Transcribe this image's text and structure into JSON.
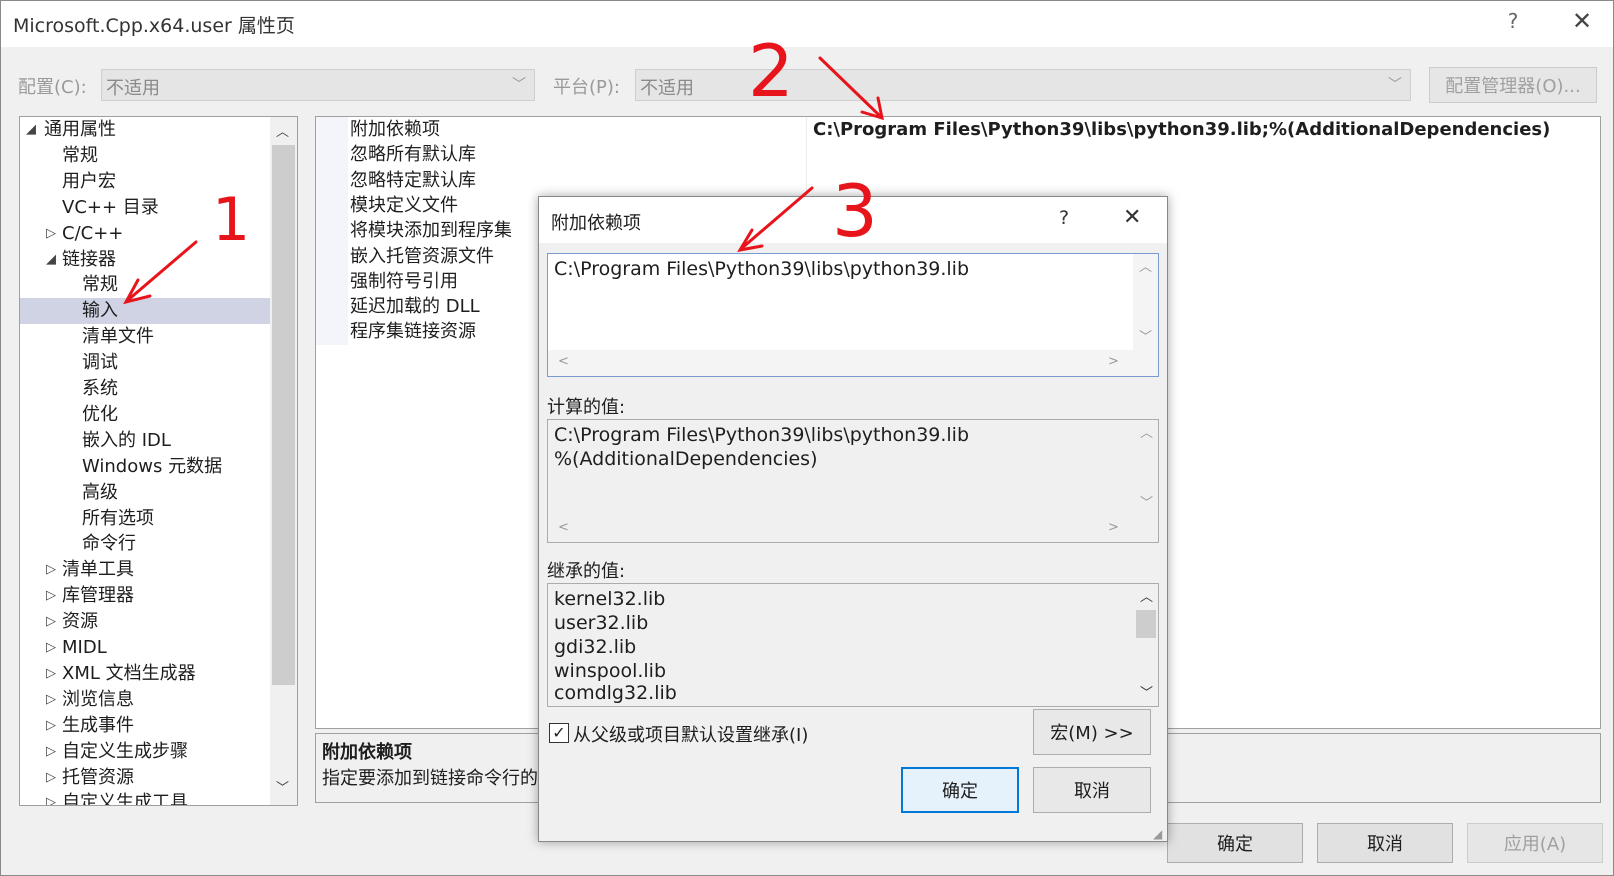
{
  "window": {
    "title": "Microsoft.Cpp.x64.user 属性页",
    "help_glyph": "?",
    "close_glyph": "✕"
  },
  "config": {
    "config_label": "配置(C):",
    "config_value": "不适用",
    "platform_label": "平台(P):",
    "platform_value": "不适用",
    "manager_button": "配置管理器(O)..."
  },
  "tree": {
    "items": [
      {
        "label": "通用属性",
        "toggle": "◢"
      },
      {
        "label": "常规",
        "toggle": ""
      },
      {
        "label": "用户宏",
        "toggle": ""
      },
      {
        "label": "VC++ 目录",
        "toggle": ""
      },
      {
        "label": "C/C++",
        "toggle": "▷"
      },
      {
        "label": "链接器",
        "toggle": "◢"
      },
      {
        "label": "常规",
        "toggle": ""
      },
      {
        "label": "输入",
        "toggle": ""
      },
      {
        "label": "清单文件",
        "toggle": ""
      },
      {
        "label": "调试",
        "toggle": ""
      },
      {
        "label": "系统",
        "toggle": ""
      },
      {
        "label": "优化",
        "toggle": ""
      },
      {
        "label": "嵌入的 IDL",
        "toggle": ""
      },
      {
        "label": "Windows 元数据",
        "toggle": ""
      },
      {
        "label": "高级",
        "toggle": ""
      },
      {
        "label": "所有选项",
        "toggle": ""
      },
      {
        "label": "命令行",
        "toggle": ""
      },
      {
        "label": "清单工具",
        "toggle": "▷"
      },
      {
        "label": "库管理器",
        "toggle": "▷"
      },
      {
        "label": "资源",
        "toggle": "▷"
      },
      {
        "label": "MIDL",
        "toggle": "▷"
      },
      {
        "label": "XML 文档生成器",
        "toggle": "▷"
      },
      {
        "label": "浏览信息",
        "toggle": "▷"
      },
      {
        "label": "生成事件",
        "toggle": "▷"
      },
      {
        "label": "自定义生成步骤",
        "toggle": "▷"
      },
      {
        "label": "托管资源",
        "toggle": "▷"
      },
      {
        "label": "自定义生成工具",
        "toggle": "▷"
      }
    ]
  },
  "grid": {
    "rows": [
      {
        "name": "附加依赖项",
        "value": "C:\\Program Files\\Python39\\libs\\python39.lib;%(AdditionalDependencies)"
      },
      {
        "name": "忽略所有默认库",
        "value": ""
      },
      {
        "name": "忽略特定默认库",
        "value": ""
      },
      {
        "name": "模块定义文件",
        "value": ""
      },
      {
        "name": "将模块添加到程序集",
        "value": ""
      },
      {
        "name": "嵌入托管资源文件",
        "value": ""
      },
      {
        "name": "强制符号引用",
        "value": ""
      },
      {
        "name": "延迟加载的 DLL",
        "value": ""
      },
      {
        "name": "程序集链接资源",
        "value": ""
      }
    ]
  },
  "description": {
    "title": "附加依赖项",
    "text": "指定要添加到链接命令行的"
  },
  "bottom_buttons": {
    "ok": "确定",
    "cancel": "取消",
    "apply": "应用(A)"
  },
  "dialog": {
    "title": "附加依赖项",
    "help_glyph": "?",
    "close_glyph": "✕",
    "edit_value": "C:\\Program Files\\Python39\\libs\\python39.lib",
    "computed_label": "计算的值:",
    "computed_lines": [
      "C:\\Program Files\\Python39\\libs\\python39.lib",
      "%(AdditionalDependencies)"
    ],
    "inherited_label": "继承的值:",
    "inherited_lines": [
      "kernel32.lib",
      "user32.lib",
      "gdi32.lib",
      "winspool.lib",
      "comdlg32.lib"
    ],
    "inherit_checkbox": "从父级或项目默认设置继承(I)",
    "inherit_checked": true,
    "macro_button": "宏(M) >>",
    "ok": "确定",
    "cancel": "取消"
  },
  "annotations": {
    "marker1": "1",
    "marker2": "2",
    "marker3": "3",
    "color": "#e8141b"
  }
}
